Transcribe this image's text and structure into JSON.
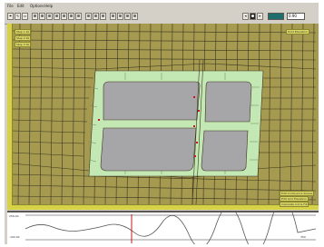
{
  "menu": {
    "items": [
      "File",
      "Edit",
      "Options",
      "Help"
    ]
  },
  "toolbar": {
    "zoom_value": "0.90",
    "buttons": [
      "⌖",
      "✎",
      "▭",
      "⊞",
      "⊞",
      "⊞",
      "⊞",
      "⊞",
      "⊞",
      "⊞",
      "⊞",
      "⊞",
      "⊞",
      "⊞",
      "⊞",
      "⊞",
      "⊞"
    ]
  },
  "viewport": {
    "corner_labels": [
      "Step 1 lbl",
      "Step 2 lbl",
      "Step 3 lbl"
    ],
    "top_right_label": "Hold Elevation",
    "bottom_right_labels": [
      "Edit Contours & Slopes",
      "Edit Grid Elevation",
      "Calculate Cut & Fill"
    ]
  },
  "profile": {
    "top_left_label": "256.00",
    "bottom_left_label": "-100.00",
    "bottom_right_label": "350"
  },
  "colors": {
    "terrain": "#a59a4f",
    "pad": "#c4e8b4",
    "building": "#a6a6a8",
    "cursor": "#c81818"
  }
}
